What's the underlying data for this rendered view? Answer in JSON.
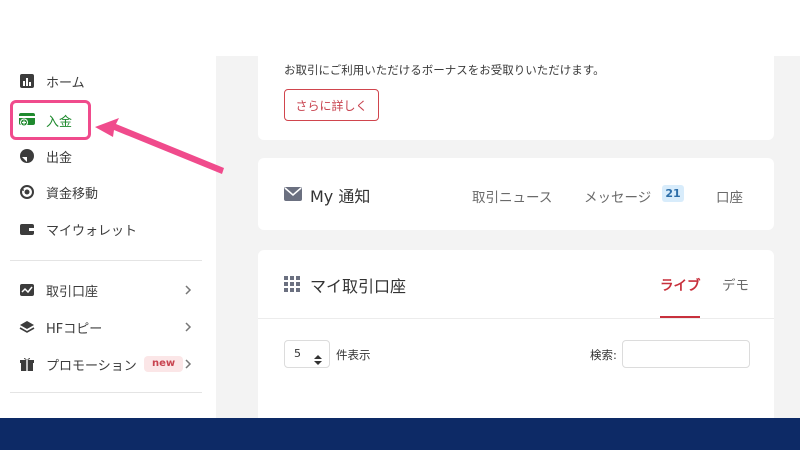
{
  "sidebar": {
    "items": [
      {
        "label": "ホーム",
        "icon": "bar-chart-icon"
      },
      {
        "label": "入金",
        "icon": "deposit-icon"
      },
      {
        "label": "出金",
        "icon": "withdraw-icon"
      },
      {
        "label": "資金移動",
        "icon": "transfer-icon"
      },
      {
        "label": "マイウォレット",
        "icon": "wallet-icon"
      },
      {
        "label": "取引口座",
        "icon": "chart-line-icon"
      },
      {
        "label": "HFコピー",
        "icon": "layers-icon"
      },
      {
        "label": "プロモーション",
        "icon": "gift-icon",
        "badge": "new"
      }
    ]
  },
  "bonus": {
    "text": "お取引にご利用いただけるボーナスをお受取りいただけます。",
    "more_label": "さらに詳しく"
  },
  "notifications": {
    "title": "My 通知",
    "tabs": {
      "news": "取引ニュース",
      "messages": "メッセージ",
      "accounts": "口座"
    },
    "messages_count": "21"
  },
  "accounts": {
    "title": "マイ取引口座",
    "tabs": {
      "live": "ライブ",
      "demo": "デモ"
    },
    "page_size": "5",
    "page_size_label": "件表示",
    "search_label": "検索:",
    "search_placeholder": ""
  },
  "colors": {
    "accent": "#c8303c",
    "active_nav": "#1f8a2e",
    "highlight": "#f04b8c",
    "footer": "#0d2a66"
  }
}
